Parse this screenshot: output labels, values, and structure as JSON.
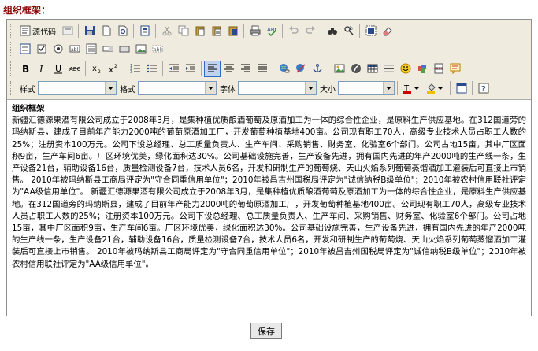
{
  "field_label": "组织框架：",
  "toolbar": {
    "source_label": "源代码",
    "style_label": "样式",
    "format_label": "格式",
    "font_label": "字体",
    "size_label": "大小",
    "style_value": "",
    "format_value": "",
    "font_value": "",
    "size_value": ""
  },
  "content": {
    "heading": "组织框架",
    "paragraph": "新疆汇德源果酒有限公司成立于2008年3月，是集种植优质酿酒葡萄及原酒加工为一体的综合性企业，是原料生产供应基地。在312国道旁的玛纳斯县，建成了目前年产能力2000吨的葡萄原酒加工厂，开发葡萄种植基地400亩。公司现有职工70人，高级专业技术人员占职工人数的25%；注册资本100万元。公司下设总经理、总工质量负责人、生产车间、采购销售、财务室、化验室6个部门。公司占地15亩，其中厂区面积9亩，生产车间6亩。厂区环境优美，绿化面积达30%。公司基础设施完善，生产设备先进，拥有国内先进的年产2000吨的生产线一条，生产设备21台，辅助设备16台，质量检测设备7台，技术人员6名，开发和研制生产的葡萄烧、天山火焰系列葡萄蒸馏酒加工灌装后可直接上市销售。 2010年被玛纳斯县工商局评定为\"守合同重信用单位\"；2010年被昌吉州国税局评定为\"诚信纳税B级单位\"；2010年被农村信用联社评定为\"AA级信用单位\"。 新疆汇德源果酒有限公司成立于2008年3月，是集种植优质酿酒葡萄及原酒加工为一体的综合性企业，是原料生产供应基地。在312国道旁的玛纳斯县，建成了目前年产能力2000吨的葡萄原酒加工厂，开发葡萄种植基地400亩。公司现有职工70人，高级专业技术人员占职工人数的25%；注册资本100万元。公司下设总经理、总工质量负责人、生产车间、采购销售、财务室、化验室6个部门。公司占地15亩，其中厂区面积9亩，生产车间6亩。厂区环境优美，绿化面积达30%。公司基础设施完善，生产设备先进，拥有国内先进的年产2000吨的生产线一条，生产设备21台，辅助设备16台，质量检测设备7台，技术人员6名，开发和研制生产的葡萄烧、天山火焰系列葡萄蒸馏酒加工灌装后可直接上市销售。 2010年被玛纳斯县工商局评定为\"守合同重信用单位\"；2010年被昌吉州国税局评定为\"诚信纳税B级单位\"；2010年被农村信用联社评定为\"AA级信用单位\"。"
  },
  "save_label": "保存"
}
